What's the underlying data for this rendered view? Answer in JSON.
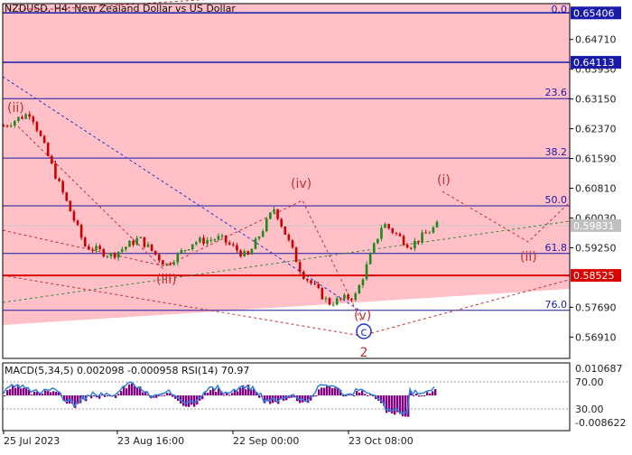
{
  "header": {
    "symbol_title": "NZDUSD, H4:  New Zealand Dollar vs US Dollar"
  },
  "indicator": {
    "title": "MACD(5,34,5) 0.002098 -0.000958 RSI(14) 70.97",
    "scale_labels": [
      "0.010687",
      "70.00",
      "30.00",
      "-0.008622"
    ]
  },
  "price_axis": {
    "ticks": [
      "0.64710",
      "0.63930",
      "0.63150",
      "0.62370",
      "0.61590",
      "0.60810",
      "0.60030",
      "0.59250",
      "0.57690",
      "0.56910"
    ],
    "boxed_levels": [
      {
        "label": "0.65406",
        "color": "#1a1aa8"
      },
      {
        "label": "0.64113",
        "color": "#1a1aa8"
      },
      {
        "label": "0.59831",
        "color": "#c0c0c0"
      },
      {
        "label": "0.58525",
        "color": "#dd0000"
      }
    ]
  },
  "time_axis": {
    "labels": [
      "25 Jul 2023",
      "23 Aug 16:00",
      "22 Sep 00:00",
      "23 Oct 08:00"
    ]
  },
  "fibonacci": {
    "labels": [
      "0.0",
      "23.6",
      "38.2",
      "50.0",
      "61.8",
      "76.0"
    ]
  },
  "wave_labels": [
    "(ii)",
    "(iii)",
    "(iv)",
    "(v)",
    "(i)",
    "(ii)",
    "c",
    "2"
  ],
  "colors": {
    "zone_fill": "#ffc0c8",
    "fib_line": "#1a1aa8",
    "support_line": "#dd0000",
    "wave_label": "#c03030",
    "candle_up": "#1e8a1e",
    "candle_down": "#cc0000",
    "macd_hist": "#800080",
    "rsi_line": "#2f7fe0"
  },
  "chart_data": {
    "type": "candlestick",
    "symbol": "NZDUSD",
    "timeframe": "H4",
    "x_labels": [
      "25 Jul 2023",
      "23 Aug 16:00",
      "22 Sep 00:00",
      "23 Oct 08:00"
    ],
    "ylim": [
      0.5635,
      0.6565
    ],
    "close_path": [
      {
        "x": "25 Jul 2023",
        "y": 0.6245
      },
      {
        "x": "late Jul",
        "y": 0.628
      },
      {
        "x": "early Aug",
        "y": 0.61
      },
      {
        "x": "mid Aug",
        "y": 0.593
      },
      {
        "x": "23 Aug 16:00",
        "y": 0.5905
      },
      {
        "x": "late Aug",
        "y": 0.595
      },
      {
        "x": "early Sep",
        "y": 0.588
      },
      {
        "x": "mid Sep",
        "y": 0.594
      },
      {
        "x": "22 Sep 00:00",
        "y": 0.595
      },
      {
        "x": "late Sep",
        "y": 0.59
      },
      {
        "x": "early Oct",
        "y": 0.603
      },
      {
        "x": "mid Oct",
        "y": 0.586
      },
      {
        "x": "23 Oct 08:00",
        "y": 0.578
      },
      {
        "x": "late Oct",
        "y": 0.58
      },
      {
        "x": "early Nov",
        "y": 0.599
      },
      {
        "x": "mid Nov",
        "y": 0.593
      },
      {
        "x": "latest",
        "y": 0.59831
      }
    ],
    "levels": {
      "fib_0.0": 0.65406,
      "fib_23.6": 0.6316,
      "fib_38.2": 0.616,
      "fib_50.0": 0.6035,
      "fib_61.8": 0.591,
      "fib_76.0": 0.5761,
      "blue_level": 0.64113,
      "red_support": 0.58525,
      "current_price": 0.59831
    },
    "macd_ylim": [
      -0.008622,
      0.010687
    ],
    "rsi_levels": [
      70,
      30
    ]
  }
}
